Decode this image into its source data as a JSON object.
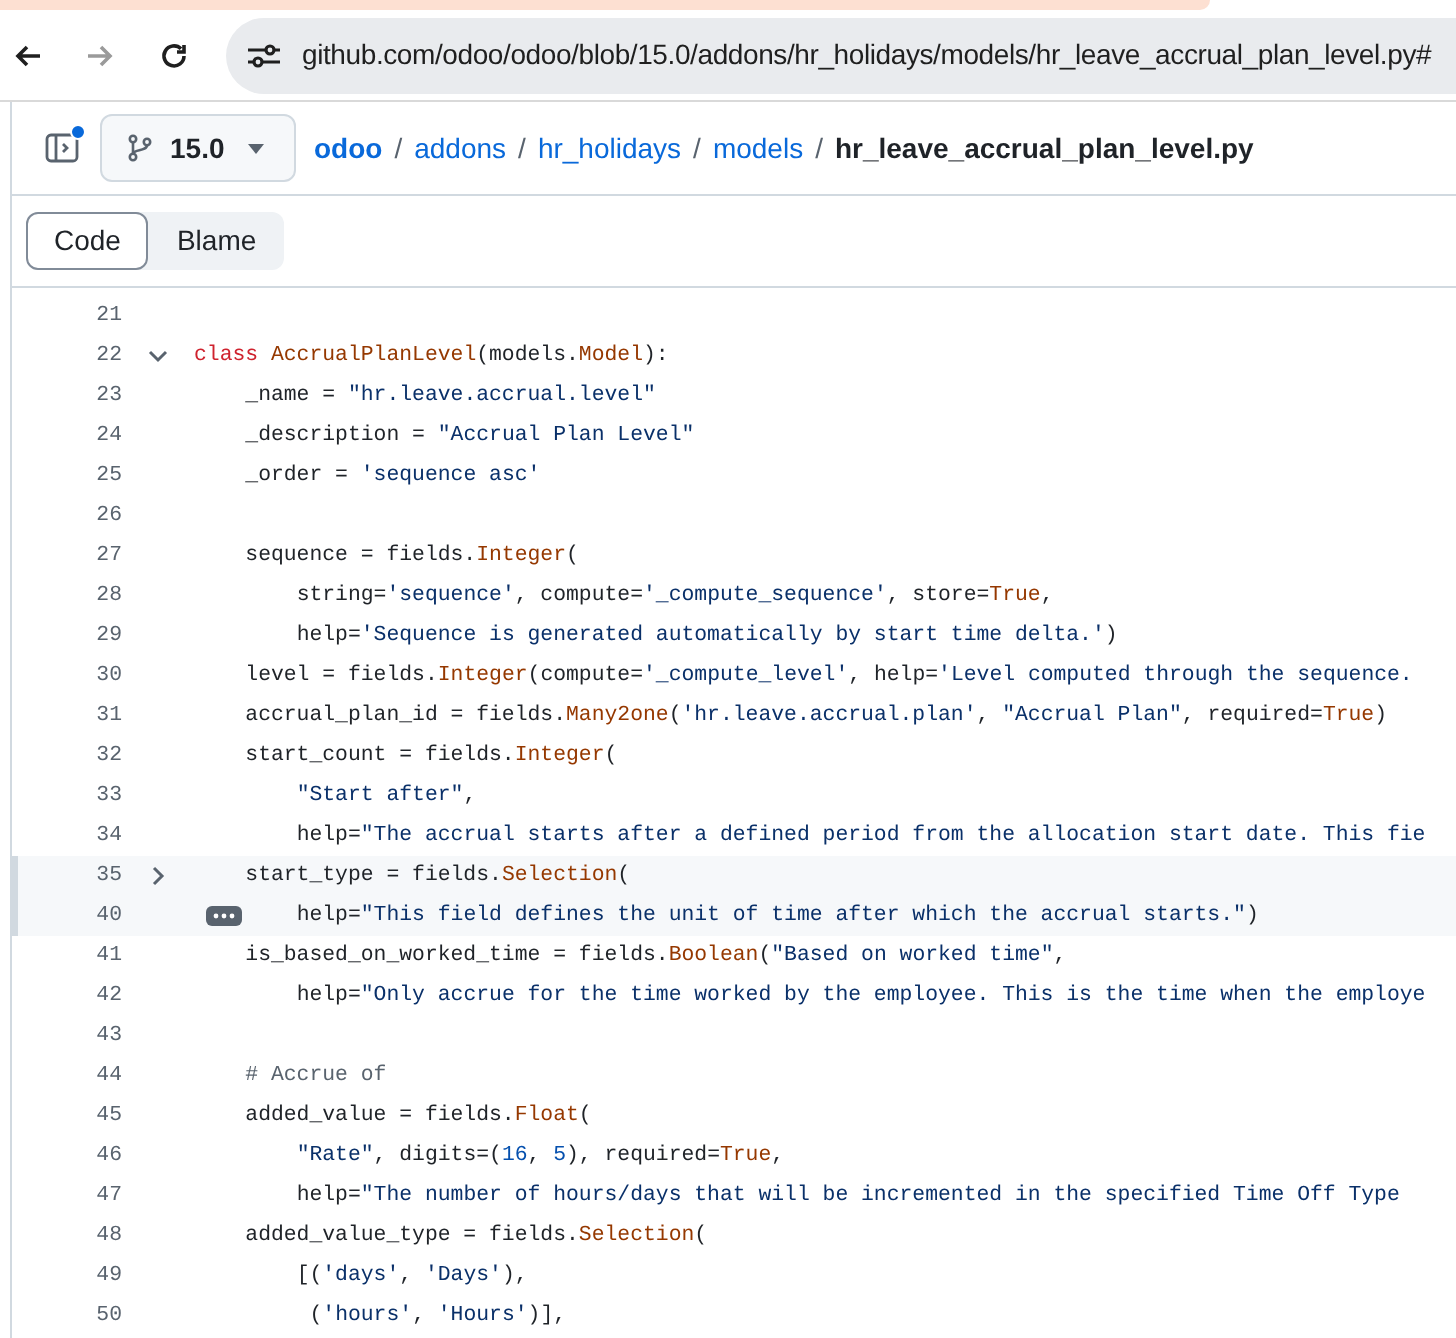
{
  "browser": {
    "url": "github.com/odoo/odoo/blob/15.0/addons/hr_holidays/models/hr_leave_accrual_plan_level.py#",
    "back_disabled": false,
    "forward_disabled": true
  },
  "header": {
    "sidebar_notification": true,
    "branch": "15.0",
    "breadcrumbs": [
      {
        "label": "odoo",
        "kind": "link"
      },
      {
        "label": "addons",
        "kind": "link"
      },
      {
        "label": "hr_holidays",
        "kind": "link"
      },
      {
        "label": "models",
        "kind": "link"
      },
      {
        "label": "hr_leave_accrual_plan_level.py",
        "kind": "current"
      }
    ],
    "separators": [
      "/",
      "/",
      "/",
      "/"
    ]
  },
  "tabs": [
    {
      "label": "Code",
      "selected": true
    },
    {
      "label": "Blame",
      "selected": false
    }
  ],
  "code": {
    "lines": [
      {
        "number": "21",
        "folded": false
      },
      {
        "number": "22",
        "folded": false,
        "expanded": true,
        "segments": [
          {
            "text": "class ",
            "kind": "keyword"
          },
          {
            "text": "AccrualPlanLevel",
            "kind": "entity"
          },
          {
            "text": "(models.",
            "kind": "plain"
          },
          {
            "text": "Model",
            "kind": "entity"
          },
          {
            "text": "):",
            "kind": "plain"
          }
        ]
      },
      {
        "number": "23",
        "folded": false,
        "segments": [
          {
            "text": "    _name = ",
            "kind": "plain"
          },
          {
            "text": "\"hr.leave.accrual.level\"",
            "kind": "string"
          }
        ]
      },
      {
        "number": "24",
        "folded": false,
        "segments": [
          {
            "text": "    _description = ",
            "kind": "plain"
          },
          {
            "text": "\"Accrual Plan Level\"",
            "kind": "string"
          }
        ]
      },
      {
        "number": "25",
        "folded": false,
        "segments": [
          {
            "text": "    _order = ",
            "kind": "plain"
          },
          {
            "text": "'sequence asc'",
            "kind": "string"
          }
        ]
      },
      {
        "number": "26",
        "folded": false
      },
      {
        "number": "27",
        "folded": false,
        "segments": [
          {
            "text": "    sequence = fields.",
            "kind": "plain"
          },
          {
            "text": "Integer",
            "kind": "entity"
          },
          {
            "text": "(",
            "kind": "plain"
          }
        ]
      },
      {
        "number": "28",
        "folded": false,
        "segments": [
          {
            "text": "        string=",
            "kind": "plain"
          },
          {
            "text": "'sequence'",
            "kind": "string"
          },
          {
            "text": ", compute=",
            "kind": "plain"
          },
          {
            "text": "'_compute_sequence'",
            "kind": "string"
          },
          {
            "text": ", store=",
            "kind": "plain"
          },
          {
            "text": "True",
            "kind": "entity"
          },
          {
            "text": ",",
            "kind": "plain"
          }
        ]
      },
      {
        "number": "29",
        "folded": false,
        "segments": [
          {
            "text": "        help=",
            "kind": "plain"
          },
          {
            "text": "'Sequence is generated automatically by start time delta.'",
            "kind": "string"
          },
          {
            "text": ")",
            "kind": "plain"
          }
        ]
      },
      {
        "number": "30",
        "folded": false,
        "segments": [
          {
            "text": "    level = fields.",
            "kind": "plain"
          },
          {
            "text": "Integer",
            "kind": "entity"
          },
          {
            "text": "(compute=",
            "kind": "plain"
          },
          {
            "text": "'_compute_level'",
            "kind": "string"
          },
          {
            "text": ", help=",
            "kind": "plain"
          },
          {
            "text": "'Level computed through the sequence.",
            "kind": "string"
          }
        ]
      },
      {
        "number": "31",
        "folded": false,
        "segments": [
          {
            "text": "    accrual_plan_id = fields.",
            "kind": "plain"
          },
          {
            "text": "Many2one",
            "kind": "entity"
          },
          {
            "text": "(",
            "kind": "plain"
          },
          {
            "text": "'hr.leave.accrual.plan'",
            "kind": "string"
          },
          {
            "text": ", ",
            "kind": "plain"
          },
          {
            "text": "\"Accrual Plan\"",
            "kind": "string"
          },
          {
            "text": ", required=",
            "kind": "plain"
          },
          {
            "text": "True",
            "kind": "entity"
          },
          {
            "text": ")",
            "kind": "plain"
          }
        ]
      },
      {
        "number": "32",
        "folded": false,
        "segments": [
          {
            "text": "    start_count = fields.",
            "kind": "plain"
          },
          {
            "text": "Integer",
            "kind": "entity"
          },
          {
            "text": "(",
            "kind": "plain"
          }
        ]
      },
      {
        "number": "33",
        "folded": false,
        "segments": [
          {
            "text": "        \"Start after\"",
            "kind": "string"
          },
          {
            "text": ",",
            "kind": "plain"
          }
        ]
      },
      {
        "number": "34",
        "folded": false,
        "segments": [
          {
            "text": "        help=",
            "kind": "plain"
          },
          {
            "text": "\"The accrual starts after a defined period from the allocation start date. This fie",
            "kind": "string"
          }
        ]
      },
      {
        "number": "35",
        "folded": true,
        "expanded": false,
        "segments": [
          {
            "text": "    start_type = fields.",
            "kind": "plain"
          },
          {
            "text": "Selection",
            "kind": "entity"
          },
          {
            "text": "(",
            "kind": "plain"
          }
        ]
      },
      {
        "number": "40",
        "folded": true,
        "segments": [
          {
            "text": "        help=",
            "kind": "plain"
          },
          {
            "text": "\"This field defines the unit of time after which the accrual starts.\"",
            "kind": "string"
          },
          {
            "text": ")",
            "kind": "plain"
          }
        ]
      },
      {
        "number": "41",
        "folded": false,
        "segments": [
          {
            "text": "    is_based_on_worked_time = fields.",
            "kind": "plain"
          },
          {
            "text": "Boolean",
            "kind": "entity"
          },
          {
            "text": "(",
            "kind": "plain"
          },
          {
            "text": "\"Based on worked time\"",
            "kind": "string"
          },
          {
            "text": ",",
            "kind": "plain"
          }
        ]
      },
      {
        "number": "42",
        "folded": false,
        "segments": [
          {
            "text": "        help=",
            "kind": "plain"
          },
          {
            "text": "\"Only accrue for the time worked by the employee. This is the time when the employe",
            "kind": "string"
          }
        ]
      },
      {
        "number": "43",
        "folded": false
      },
      {
        "number": "44",
        "folded": false,
        "segments": [
          {
            "text": "    # Accrue of",
            "kind": "comment"
          }
        ]
      },
      {
        "number": "45",
        "folded": false,
        "segments": [
          {
            "text": "    added_value = fields.",
            "kind": "plain"
          },
          {
            "text": "Float",
            "kind": "entity"
          },
          {
            "text": "(",
            "kind": "plain"
          }
        ]
      },
      {
        "number": "46",
        "folded": false,
        "segments": [
          {
            "text": "        \"Rate\"",
            "kind": "string"
          },
          {
            "text": ", digits=(",
            "kind": "plain"
          },
          {
            "text": "16",
            "kind": "number"
          },
          {
            "text": ", ",
            "kind": "plain"
          },
          {
            "text": "5",
            "kind": "number"
          },
          {
            "text": "), required=",
            "kind": "plain"
          },
          {
            "text": "True",
            "kind": "entity"
          },
          {
            "text": ",",
            "kind": "plain"
          }
        ]
      },
      {
        "number": "47",
        "folded": false,
        "segments": [
          {
            "text": "        help=",
            "kind": "plain"
          },
          {
            "text": "\"The number of hours/days that will be incremented in the specified Time Off Type",
            "kind": "string"
          }
        ]
      },
      {
        "number": "48",
        "folded": false,
        "segments": [
          {
            "text": "    added_value_type = fields.",
            "kind": "plain"
          },
          {
            "text": "Selection",
            "kind": "entity"
          },
          {
            "text": "(",
            "kind": "plain"
          }
        ]
      },
      {
        "number": "49",
        "folded": false,
        "segments": [
          {
            "text": "        [(",
            "kind": "plain"
          },
          {
            "text": "'days'",
            "kind": "string"
          },
          {
            "text": ", ",
            "kind": "plain"
          },
          {
            "text": "'Days'",
            "kind": "string"
          },
          {
            "text": "),",
            "kind": "plain"
          }
        ]
      },
      {
        "number": "50",
        "folded": false,
        "segments": [
          {
            "text": "         (",
            "kind": "plain"
          },
          {
            "text": "'hours'",
            "kind": "string"
          },
          {
            "text": ", ",
            "kind": "plain"
          },
          {
            "text": "'Hours'",
            "kind": "string"
          },
          {
            "text": ")],",
            "kind": "plain"
          }
        ]
      }
    ]
  }
}
